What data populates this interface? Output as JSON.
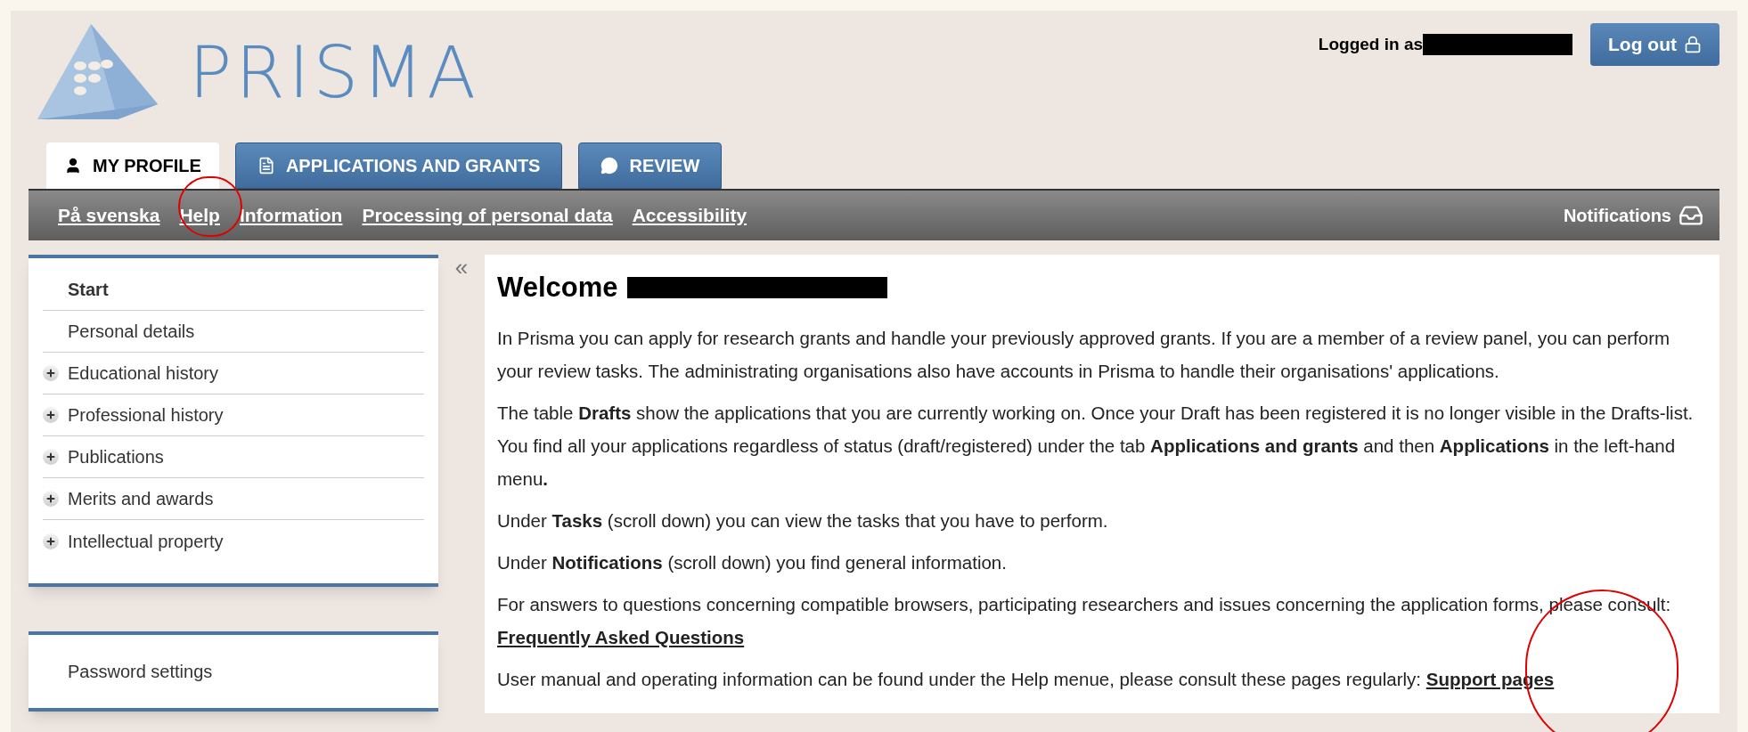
{
  "header": {
    "logo_text": "PRISMA",
    "logged_in_label": "Logged in as",
    "logout_button": "Log out"
  },
  "tabs": [
    {
      "label": "MY PROFILE",
      "kind": "user",
      "selected": true
    },
    {
      "label": "APPLICATIONS AND GRANTS",
      "kind": "document",
      "selected": false
    },
    {
      "label": "REVIEW",
      "kind": "comment",
      "selected": false
    }
  ],
  "subnav": {
    "links": [
      "På svenska",
      "Help",
      "Information",
      "Processing of personal data",
      "Accessibility"
    ],
    "notifications": "Notifications"
  },
  "sidebar": {
    "items": [
      {
        "label": "Start",
        "kind": "plain",
        "selected": true
      },
      {
        "label": "Personal details",
        "kind": "plain",
        "selected": false
      },
      {
        "label": "Educational history",
        "kind": "expandable",
        "selected": false
      },
      {
        "label": "Professional history",
        "kind": "expandable",
        "selected": false
      },
      {
        "label": "Publications",
        "kind": "expandable",
        "selected": false
      },
      {
        "label": "Merits and awards",
        "kind": "expandable",
        "selected": false
      },
      {
        "label": "Intellectual property",
        "kind": "expandable",
        "selected": false
      }
    ],
    "settings_items": [
      {
        "label": "Password settings",
        "selected": false
      }
    ],
    "collapse": "«"
  },
  "main": {
    "heading": "Welcome",
    "paragraphs": [
      {
        "text": "In Prisma you can apply for research grants and handle your previously approved grants. If you are a member of a review panel, you can perform your review tasks. The administrating organisations also have accounts in Prisma to handle their organisations' applications."
      },
      {
        "text": "The table **Drafts** show the applications that you are currently working on. Once your Draft has been registered it is no longer visible in the Drafts-list. You find all your applications regardless of status (draft/registered) under the tab **Applications and grants** and then **Applications** in the left-hand menu**.**"
      },
      {
        "text": "Under **Tasks** (scroll down) you can view the tasks that you have to perform."
      },
      {
        "text": "Under **Notifications** (scroll down) you find general information."
      },
      {
        "text": "For answers to questions concerning compatible browsers, participating researchers and issues concerning the application forms, please consult: ",
        "link": "Frequently Asked Questions"
      },
      {
        "text": "User manual and operating information can be found under the Help menue, please consult these pages regularly: ",
        "link": "Support pages"
      }
    ]
  }
}
